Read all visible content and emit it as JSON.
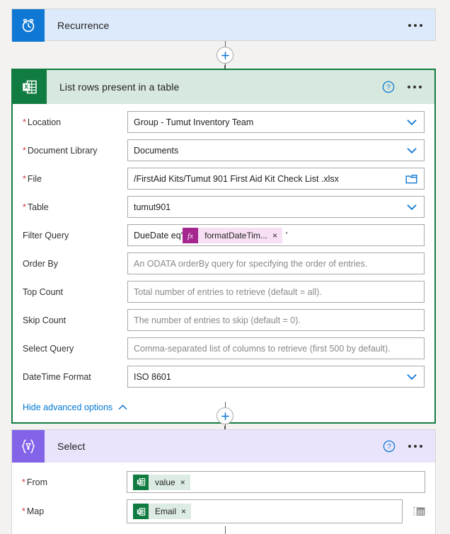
{
  "flow": {
    "trigger": {
      "title": "Recurrence",
      "icon": "alarm-clock-icon",
      "accent_color": "#0f78d4",
      "header_bg": "#dceafb"
    },
    "actions": [
      {
        "id": "list-rows-present-in-a-table",
        "title": "List rows present in a table",
        "icon": "excel-icon",
        "accent_color": "#107c41",
        "header_bg": "#d7e8de",
        "fields": [
          {
            "label": "Location",
            "required": true,
            "value": "Group - Tumut Inventory Team",
            "control": "dropdown"
          },
          {
            "label": "Document Library",
            "required": true,
            "value": "Documents",
            "control": "dropdown"
          },
          {
            "label": "File",
            "required": true,
            "value": "/FirstAid Kits/Tumut 901 First Aid Kit Check List .xlsx",
            "control": "file-picker"
          },
          {
            "label": "Table",
            "required": true,
            "value": "tumut901",
            "control": "dropdown"
          },
          {
            "label": "Filter Query",
            "required": false,
            "control": "token-text",
            "prefix_text": "DueDate eq'",
            "token": {
              "label": "formatDateTim...",
              "icon": "fx-icon",
              "remove": "×"
            },
            "suffix_text": "'"
          },
          {
            "label": "Order By",
            "required": false,
            "placeholder": "An ODATA orderBy query for specifying the order of entries.",
            "control": "text"
          },
          {
            "label": "Top Count",
            "required": false,
            "placeholder": "Total number of entries to retrieve (default = all).",
            "control": "text"
          },
          {
            "label": "Skip Count",
            "required": false,
            "placeholder": "The number of entries to skip (default = 0).",
            "control": "text"
          },
          {
            "label": "Select Query",
            "required": false,
            "placeholder": "Comma-separated list of columns to retrieve (first 500 by default).",
            "control": "text"
          },
          {
            "label": "DateTime Format",
            "required": false,
            "value": "ISO 8601",
            "control": "dropdown"
          }
        ],
        "advanced_options_label": "Hide advanced options",
        "advanced_options_state": "expanded"
      },
      {
        "id": "select",
        "title": "Select",
        "icon": "select-braces-icon",
        "accent_color": "#8363e8",
        "header_bg": "#e9e4fb",
        "fields": [
          {
            "label": "From",
            "required": true,
            "control": "token",
            "token": {
              "label": "value",
              "icon": "excel-icon",
              "remove": "×"
            }
          },
          {
            "label": "Map",
            "required": true,
            "control": "token",
            "token": {
              "label": "Email",
              "icon": "excel-icon",
              "remove": "×"
            },
            "trailing_icon": "switch-to-text-mode-icon"
          }
        ]
      }
    ],
    "header_icons": {
      "help": "help-circle-icon",
      "menu": "ellipsis-menu-icon"
    },
    "connector": {
      "add_step_icon": "plus-icon",
      "arrow_icon": "arrow-down-icon"
    }
  }
}
